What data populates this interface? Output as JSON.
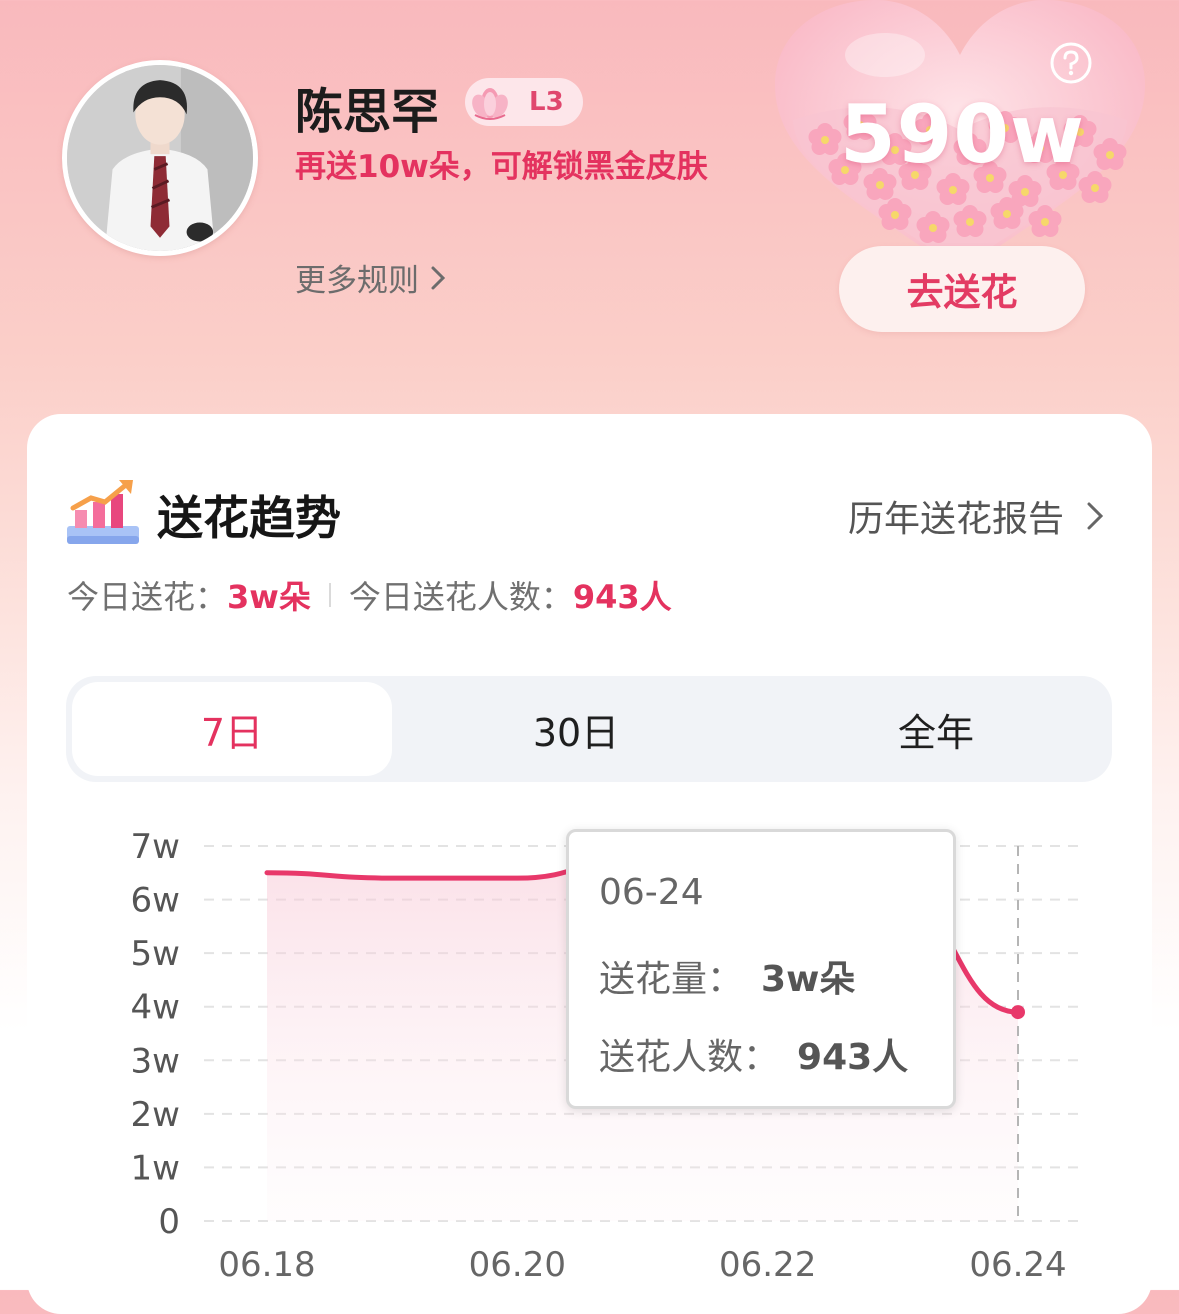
{
  "profile": {
    "name": "陈思罕",
    "level": "L3",
    "unlock_tip": "再送10w朵，可解锁黑金皮肤",
    "more_rules": "更多规则"
  },
  "heart": {
    "total": "590w",
    "send_button": "去送花",
    "help_icon": "question-mark-icon"
  },
  "trend": {
    "title": "送花趋势",
    "history_link": "历年送花报告",
    "today_flowers_label": "今日送花：",
    "today_flowers_value": "3w朵",
    "today_people_label": "今日送花人数：",
    "today_people_value": "943人"
  },
  "tabs": [
    {
      "label": "7日",
      "active": true
    },
    {
      "label": "30日",
      "active": false
    },
    {
      "label": "全年",
      "active": false
    }
  ],
  "tooltip": {
    "date": "06-24",
    "amount_label": "送花量：",
    "amount_value": "3w朵",
    "people_label": "送花人数：",
    "people_value": "943人"
  },
  "colors": {
    "accent": "#e4325f",
    "line": "#e8386a",
    "tab_bg": "#f1f3f7"
  },
  "chart_data": {
    "type": "area",
    "x": [
      "06.18",
      "06.19",
      "06.20",
      "06.21",
      "06.22",
      "06.23",
      "06.24"
    ],
    "x_tick_labels": [
      "06.18",
      "06.20",
      "06.22",
      "06.24"
    ],
    "values": [
      6.5,
      6.4,
      6.4,
      6.8,
      6.9,
      6.1,
      3.9
    ],
    "y_unit": "w",
    "y_ticks": [
      "0",
      "1w",
      "2w",
      "3w",
      "4w",
      "5w",
      "6w",
      "7w"
    ],
    "ylim": [
      0,
      7
    ],
    "grid": true,
    "highlight_index": 6
  }
}
